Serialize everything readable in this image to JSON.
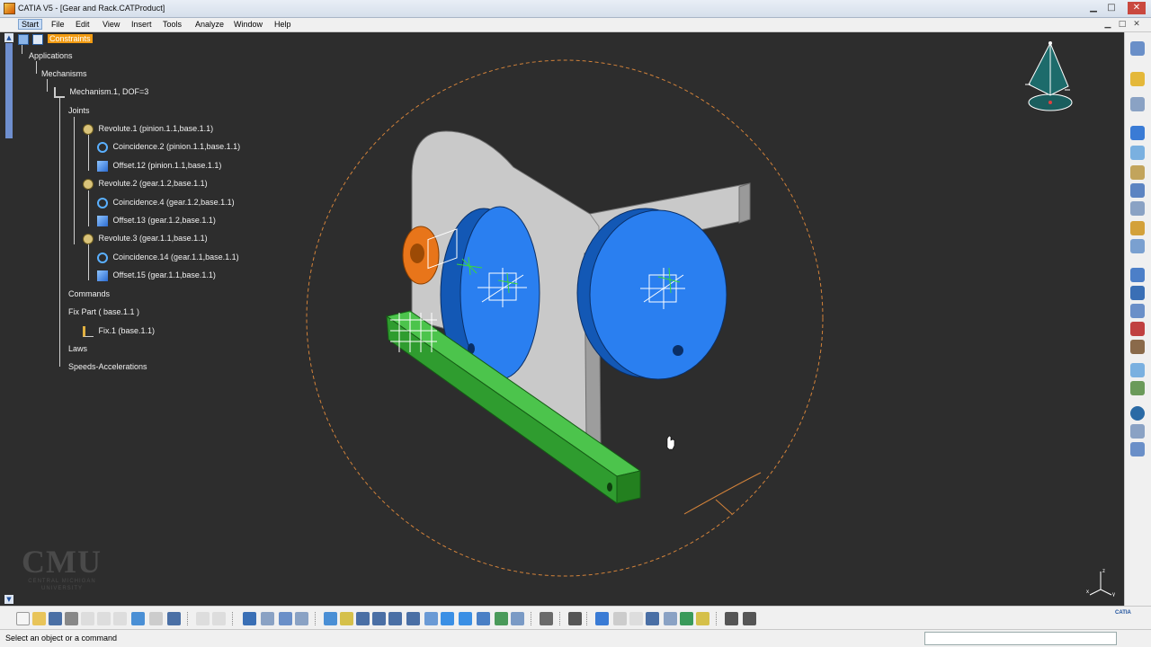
{
  "window": {
    "title": "CATIA V5 - [Gear and Rack.CATProduct]",
    "minimize_glyph": "▁",
    "maximize_glyph": "□",
    "close_glyph": "✕"
  },
  "menu": {
    "items": [
      "Start",
      "File",
      "Edit",
      "View",
      "Insert",
      "Tools",
      "Analyze",
      "Window",
      "Help"
    ],
    "active": "Start"
  },
  "tree": {
    "nodes": [
      {
        "label": "Constraints",
        "icon": "constraints-icon",
        "highlight": true
      },
      {
        "label": "Applications",
        "icon": ""
      },
      {
        "label": "Mechanisms",
        "icon": ""
      },
      {
        "label": "Mechanism.1, DOF=3",
        "icon": "mechanism-icon"
      },
      {
        "label": "Joints",
        "icon": ""
      },
      {
        "label": "Revolute.1 (pinion.1.1,base.1.1)",
        "icon": "revolute-joint-icon"
      },
      {
        "label": "Coincidence.2 (pinion.1.1,base.1.1)",
        "icon": "coincidence-icon"
      },
      {
        "label": "Offset.12 (pinion.1.1,base.1.1)",
        "icon": "offset-icon"
      },
      {
        "label": "Revolute.2 (gear.1.2,base.1.1)",
        "icon": "revolute-joint-icon"
      },
      {
        "label": "Coincidence.4 (gear.1.2,base.1.1)",
        "icon": "coincidence-icon"
      },
      {
        "label": "Offset.13 (gear.1.2,base.1.1)",
        "icon": "offset-icon"
      },
      {
        "label": "Revolute.3 (gear.1.1,base.1.1)",
        "icon": "revolute-joint-icon"
      },
      {
        "label": "Coincidence.14 (gear.1.1,base.1.1)",
        "icon": "coincidence-icon"
      },
      {
        "label": "Offset.15 (gear.1.1,base.1.1)",
        "icon": "offset-icon"
      },
      {
        "label": "Commands",
        "icon": ""
      },
      {
        "label": "Fix Part ( base.1.1 )",
        "icon": ""
      },
      {
        "label": "Fix.1 (base.1.1)",
        "icon": "fix-icon"
      },
      {
        "label": "Laws",
        "icon": ""
      },
      {
        "label": "Speeds-Accelerations",
        "icon": ""
      }
    ]
  },
  "watermark": {
    "logo": "CMU",
    "subtitle_1": "CENTRAL MICHIGAN",
    "subtitle_2": "UNIVERSITY"
  },
  "status": {
    "message": "Select an object or a command",
    "command_input": ""
  },
  "brand": {
    "catia_logo": "CATIA"
  },
  "colors": {
    "background": "#2d2d2d",
    "plate": "#bdbdbd",
    "gear_blue": "#1f78e6",
    "pinion_orange": "#f07d1a",
    "rack_green": "#2fa82f",
    "highlight": "#f39c12",
    "sphere_dash": "#d2823a"
  }
}
